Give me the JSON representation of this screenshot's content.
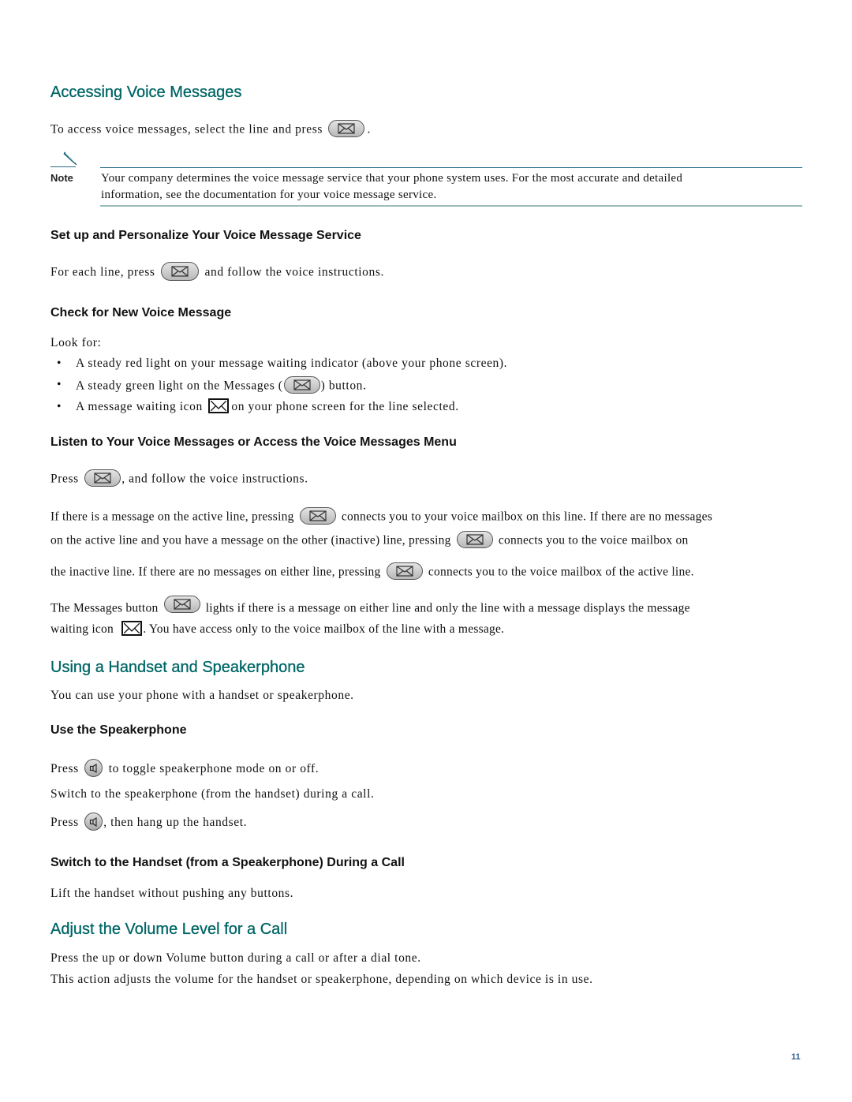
{
  "sections": {
    "accessing": {
      "title": "Accessing Voice Messages",
      "intro_before": "To access voice messages, select the line and press",
      "intro_after": ".",
      "note_label": "Note",
      "note_line1": "Your company determines the voice message service that your phone system uses. For the most accurate and detailed",
      "note_line2": "information, see the documentation for your voice message service."
    },
    "setup": {
      "title": "Set up and Personalize Your Voice Message Service",
      "text_before": "For each line, press",
      "text_after": "and follow the voice instructions."
    },
    "check": {
      "title": "Check for New Voice Message",
      "look_for": "Look for:",
      "bullets": [
        {
          "before": "A steady red light on your message waiting indicator (above your phone screen).",
          "after": ""
        },
        {
          "before": "A steady green light on the Messages (",
          "after": ") button."
        },
        {
          "before": "A message waiting icon",
          "after": "on your phone screen for the line selected."
        }
      ]
    },
    "listen": {
      "title": "Listen to Your Voice Messages or Access the Voice Messages Menu",
      "press_before": "Press",
      "press_after": ", and follow the voice instructions.",
      "para1_l1_before": "If there is a message on the active line, pressing",
      "para1_l1_after": "connects you to your voice mailbox on this line. If there are no messages",
      "para1_l2_before": "on the active line and you have a message on the other (inactive) line, pressing",
      "para1_l2_after": "connects you to the voice mailbox on",
      "para1_l3_before": "the inactive line. If there are no messages on either line, pressing",
      "para1_l3_after": "connects you to the voice mailbox of the active line.",
      "para2_l1_before": "The Messages button",
      "para2_l1_after": "lights if there is a message on either line and only the line with a message displays the message",
      "para2_l2_before": "waiting icon",
      "para2_l2_after": ". You have access only to the voice mailbox of the line with a message."
    },
    "handset": {
      "title": "Using a Handset and Speakerphone",
      "intro": "You can use your phone with a handset or speakerphone."
    },
    "speaker": {
      "title": "Use the Speakerphone",
      "line1_before": "Press",
      "line1_after": "to toggle speakerphone mode on or off.",
      "line2": "Switch to the speakerphone (from the handset) during a call.",
      "line3_before": "Press",
      "line3_after": ", then hang up the handset."
    },
    "switch": {
      "title": "Switch to the Handset (from a Speakerphone) During a Call",
      "text": "Lift the handset without pushing any buttons."
    },
    "volume": {
      "title": "Adjust the Volume Level for a Call",
      "line1": "Press the up or down Volume button during a call or after a dial tone.",
      "line2": "This action adjusts the volume for the handset or speakerphone, depending on which device is in use."
    }
  },
  "page_number": "11",
  "colors": {
    "heading": "#006666",
    "note_rule_top": "#2a6a8a",
    "note_rule_bottom": "#9bbcbc",
    "page_number": "#2a5a8a"
  }
}
